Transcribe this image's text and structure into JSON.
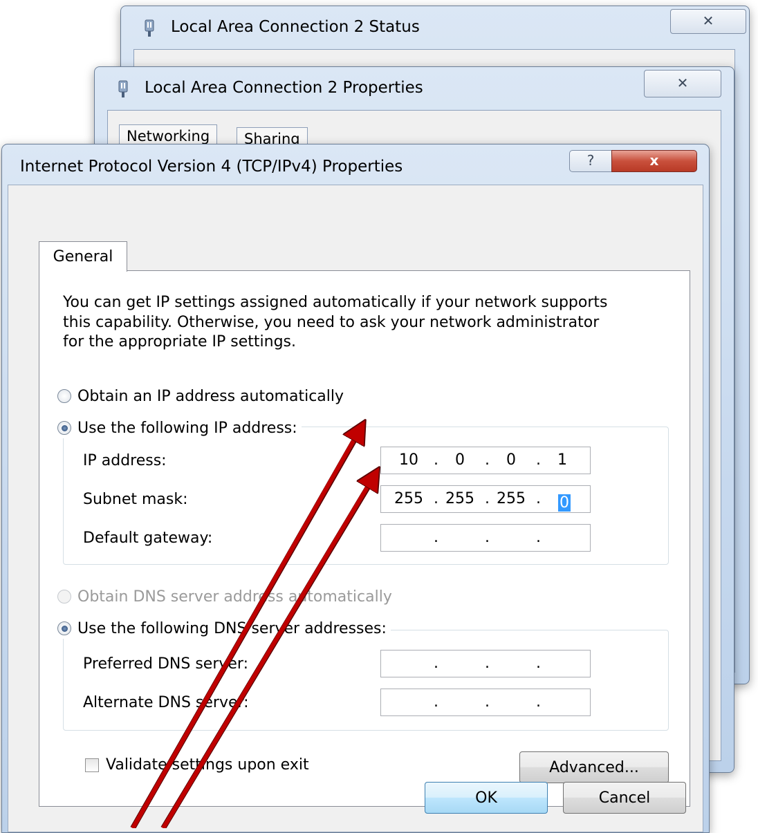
{
  "status_window": {
    "title": "Local Area Connection 2 Status",
    "close_label": "✕"
  },
  "properties_window": {
    "title": "Local Area Connection 2 Properties",
    "close_label": "✕",
    "tabs": [
      "Networking",
      "Sharing"
    ]
  },
  "ipv4_dialog": {
    "title": "Internet Protocol Version 4 (TCP/IPv4) Properties",
    "help_label": "?",
    "close_label": "x",
    "tab_general": "General",
    "description": "You can get IP settings assigned automatically if your network supports\nthis capability. Otherwise, you need to ask your network administrator\nfor the appropriate IP settings.",
    "ip_section": {
      "obtain_auto_label": "Obtain an IP address automatically",
      "use_following_label": "Use the following IP address:",
      "fields": {
        "ip_address": {
          "label": "IP address:",
          "octets": [
            "10",
            "0",
            "0",
            "1"
          ]
        },
        "subnet_mask": {
          "label": "Subnet mask:",
          "octets": [
            "255",
            "255",
            "255",
            "0"
          ]
        },
        "default_gateway": {
          "label": "Default gateway:",
          "octets": [
            "",
            "",
            "",
            ""
          ]
        }
      }
    },
    "dns_section": {
      "obtain_auto_label": "Obtain DNS server address automatically",
      "use_following_label": "Use the following DNS server addresses:",
      "preferred": {
        "label": "Preferred DNS server:",
        "octets": [
          "",
          "",
          "",
          ""
        ]
      },
      "alternate": {
        "label": "Alternate DNS server:",
        "octets": [
          "",
          "",
          "",
          ""
        ]
      }
    },
    "validate_label": "Validate settings upon exit",
    "advanced_label": "Advanced...",
    "ok_label": "OK",
    "cancel_label": "Cancel"
  },
  "annotation_color": "#c00000"
}
